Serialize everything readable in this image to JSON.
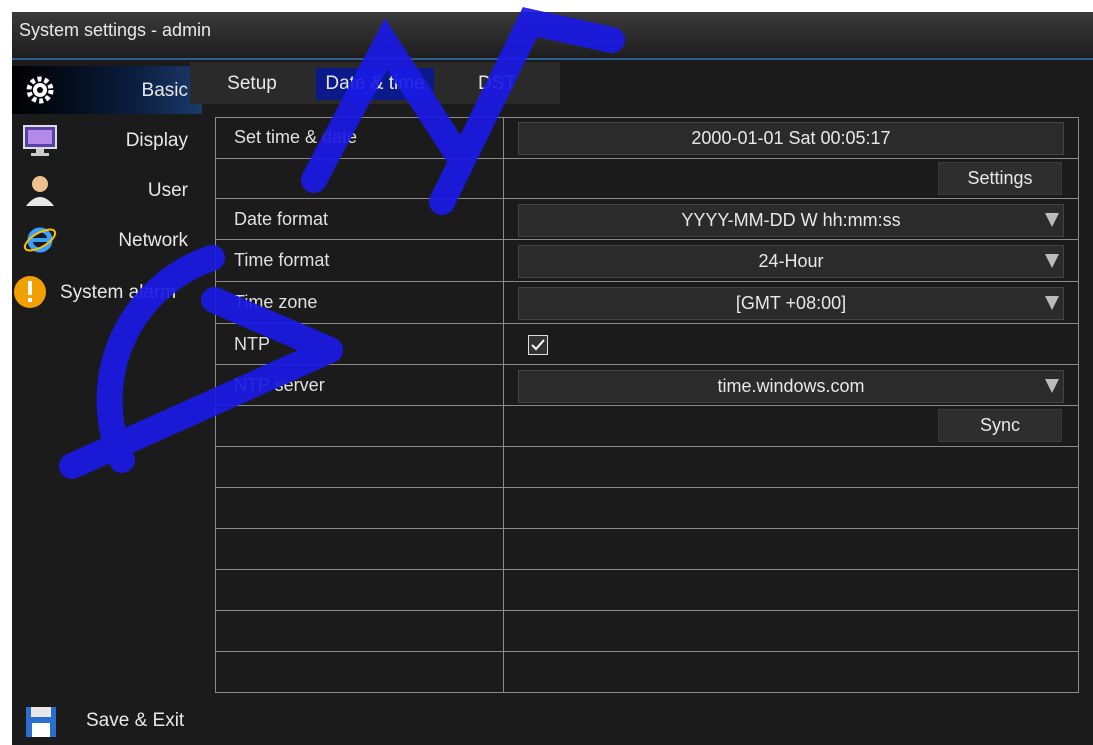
{
  "window": {
    "title": "System settings - admin"
  },
  "sidebar": {
    "items": [
      {
        "label": "Basic",
        "icon": "gear-icon",
        "selected": true
      },
      {
        "label": "Display",
        "icon": "monitor-icon"
      },
      {
        "label": "User",
        "icon": "user-icon"
      },
      {
        "label": "Network",
        "icon": "network-browser-icon"
      },
      {
        "label": "System alarm",
        "icon": "alarm-warning-icon"
      }
    ],
    "save_exit": {
      "label": "Save & Exit",
      "icon": "floppy-disk-icon"
    }
  },
  "tabs": [
    {
      "label": "Setup"
    },
    {
      "label": "Date & time",
      "active": true
    },
    {
      "label": "DST"
    }
  ],
  "form": {
    "set_time_date": {
      "label": "Set time & date",
      "value": "2000-01-01 Sat 00:05:17"
    },
    "settings_button": "Settings",
    "date_format": {
      "label": "Date format",
      "value": "YYYY-MM-DD W hh:mm:ss"
    },
    "time_format": {
      "label": "Time format",
      "value": "24-Hour"
    },
    "time_zone": {
      "label": "Time zone",
      "value": "[GMT +08:00]"
    },
    "ntp": {
      "label": "NTP",
      "checked": true
    },
    "ntp_server": {
      "label": "NTP server",
      "value": "time.windows.com"
    },
    "sync_button": "Sync"
  },
  "colors": {
    "accent": "#0b1a8a",
    "background": "#1b1b1b",
    "grid": "#8a8a8a",
    "watermark": "#1a1ae6"
  }
}
